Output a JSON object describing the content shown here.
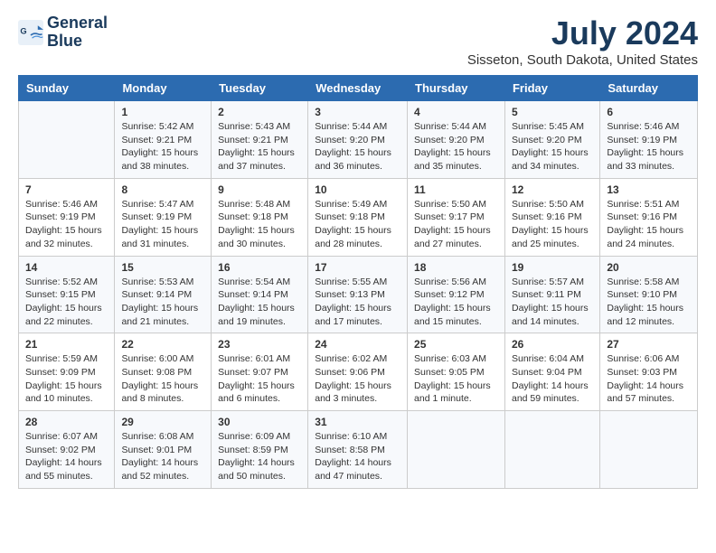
{
  "logo": {
    "line1": "General",
    "line2": "Blue"
  },
  "title": "July 2024",
  "subtitle": "Sisseton, South Dakota, United States",
  "weekdays": [
    "Sunday",
    "Monday",
    "Tuesday",
    "Wednesday",
    "Thursday",
    "Friday",
    "Saturday"
  ],
  "weeks": [
    [
      {
        "day": "",
        "sunrise": "",
        "sunset": "",
        "daylight": ""
      },
      {
        "day": "1",
        "sunrise": "Sunrise: 5:42 AM",
        "sunset": "Sunset: 9:21 PM",
        "daylight": "Daylight: 15 hours and 38 minutes."
      },
      {
        "day": "2",
        "sunrise": "Sunrise: 5:43 AM",
        "sunset": "Sunset: 9:21 PM",
        "daylight": "Daylight: 15 hours and 37 minutes."
      },
      {
        "day": "3",
        "sunrise": "Sunrise: 5:44 AM",
        "sunset": "Sunset: 9:20 PM",
        "daylight": "Daylight: 15 hours and 36 minutes."
      },
      {
        "day": "4",
        "sunrise": "Sunrise: 5:44 AM",
        "sunset": "Sunset: 9:20 PM",
        "daylight": "Daylight: 15 hours and 35 minutes."
      },
      {
        "day": "5",
        "sunrise": "Sunrise: 5:45 AM",
        "sunset": "Sunset: 9:20 PM",
        "daylight": "Daylight: 15 hours and 34 minutes."
      },
      {
        "day": "6",
        "sunrise": "Sunrise: 5:46 AM",
        "sunset": "Sunset: 9:19 PM",
        "daylight": "Daylight: 15 hours and 33 minutes."
      }
    ],
    [
      {
        "day": "7",
        "sunrise": "Sunrise: 5:46 AM",
        "sunset": "Sunset: 9:19 PM",
        "daylight": "Daylight: 15 hours and 32 minutes."
      },
      {
        "day": "8",
        "sunrise": "Sunrise: 5:47 AM",
        "sunset": "Sunset: 9:19 PM",
        "daylight": "Daylight: 15 hours and 31 minutes."
      },
      {
        "day": "9",
        "sunrise": "Sunrise: 5:48 AM",
        "sunset": "Sunset: 9:18 PM",
        "daylight": "Daylight: 15 hours and 30 minutes."
      },
      {
        "day": "10",
        "sunrise": "Sunrise: 5:49 AM",
        "sunset": "Sunset: 9:18 PM",
        "daylight": "Daylight: 15 hours and 28 minutes."
      },
      {
        "day": "11",
        "sunrise": "Sunrise: 5:50 AM",
        "sunset": "Sunset: 9:17 PM",
        "daylight": "Daylight: 15 hours and 27 minutes."
      },
      {
        "day": "12",
        "sunrise": "Sunrise: 5:50 AM",
        "sunset": "Sunset: 9:16 PM",
        "daylight": "Daylight: 15 hours and 25 minutes."
      },
      {
        "day": "13",
        "sunrise": "Sunrise: 5:51 AM",
        "sunset": "Sunset: 9:16 PM",
        "daylight": "Daylight: 15 hours and 24 minutes."
      }
    ],
    [
      {
        "day": "14",
        "sunrise": "Sunrise: 5:52 AM",
        "sunset": "Sunset: 9:15 PM",
        "daylight": "Daylight: 15 hours and 22 minutes."
      },
      {
        "day": "15",
        "sunrise": "Sunrise: 5:53 AM",
        "sunset": "Sunset: 9:14 PM",
        "daylight": "Daylight: 15 hours and 21 minutes."
      },
      {
        "day": "16",
        "sunrise": "Sunrise: 5:54 AM",
        "sunset": "Sunset: 9:14 PM",
        "daylight": "Daylight: 15 hours and 19 minutes."
      },
      {
        "day": "17",
        "sunrise": "Sunrise: 5:55 AM",
        "sunset": "Sunset: 9:13 PM",
        "daylight": "Daylight: 15 hours and 17 minutes."
      },
      {
        "day": "18",
        "sunrise": "Sunrise: 5:56 AM",
        "sunset": "Sunset: 9:12 PM",
        "daylight": "Daylight: 15 hours and 15 minutes."
      },
      {
        "day": "19",
        "sunrise": "Sunrise: 5:57 AM",
        "sunset": "Sunset: 9:11 PM",
        "daylight": "Daylight: 15 hours and 14 minutes."
      },
      {
        "day": "20",
        "sunrise": "Sunrise: 5:58 AM",
        "sunset": "Sunset: 9:10 PM",
        "daylight": "Daylight: 15 hours and 12 minutes."
      }
    ],
    [
      {
        "day": "21",
        "sunrise": "Sunrise: 5:59 AM",
        "sunset": "Sunset: 9:09 PM",
        "daylight": "Daylight: 15 hours and 10 minutes."
      },
      {
        "day": "22",
        "sunrise": "Sunrise: 6:00 AM",
        "sunset": "Sunset: 9:08 PM",
        "daylight": "Daylight: 15 hours and 8 minutes."
      },
      {
        "day": "23",
        "sunrise": "Sunrise: 6:01 AM",
        "sunset": "Sunset: 9:07 PM",
        "daylight": "Daylight: 15 hours and 6 minutes."
      },
      {
        "day": "24",
        "sunrise": "Sunrise: 6:02 AM",
        "sunset": "Sunset: 9:06 PM",
        "daylight": "Daylight: 15 hours and 3 minutes."
      },
      {
        "day": "25",
        "sunrise": "Sunrise: 6:03 AM",
        "sunset": "Sunset: 9:05 PM",
        "daylight": "Daylight: 15 hours and 1 minute."
      },
      {
        "day": "26",
        "sunrise": "Sunrise: 6:04 AM",
        "sunset": "Sunset: 9:04 PM",
        "daylight": "Daylight: 14 hours and 59 minutes."
      },
      {
        "day": "27",
        "sunrise": "Sunrise: 6:06 AM",
        "sunset": "Sunset: 9:03 PM",
        "daylight": "Daylight: 14 hours and 57 minutes."
      }
    ],
    [
      {
        "day": "28",
        "sunrise": "Sunrise: 6:07 AM",
        "sunset": "Sunset: 9:02 PM",
        "daylight": "Daylight: 14 hours and 55 minutes."
      },
      {
        "day": "29",
        "sunrise": "Sunrise: 6:08 AM",
        "sunset": "Sunset: 9:01 PM",
        "daylight": "Daylight: 14 hours and 52 minutes."
      },
      {
        "day": "30",
        "sunrise": "Sunrise: 6:09 AM",
        "sunset": "Sunset: 8:59 PM",
        "daylight": "Daylight: 14 hours and 50 minutes."
      },
      {
        "day": "31",
        "sunrise": "Sunrise: 6:10 AM",
        "sunset": "Sunset: 8:58 PM",
        "daylight": "Daylight: 14 hours and 47 minutes."
      },
      {
        "day": "",
        "sunrise": "",
        "sunset": "",
        "daylight": ""
      },
      {
        "day": "",
        "sunrise": "",
        "sunset": "",
        "daylight": ""
      },
      {
        "day": "",
        "sunrise": "",
        "sunset": "",
        "daylight": ""
      }
    ]
  ]
}
